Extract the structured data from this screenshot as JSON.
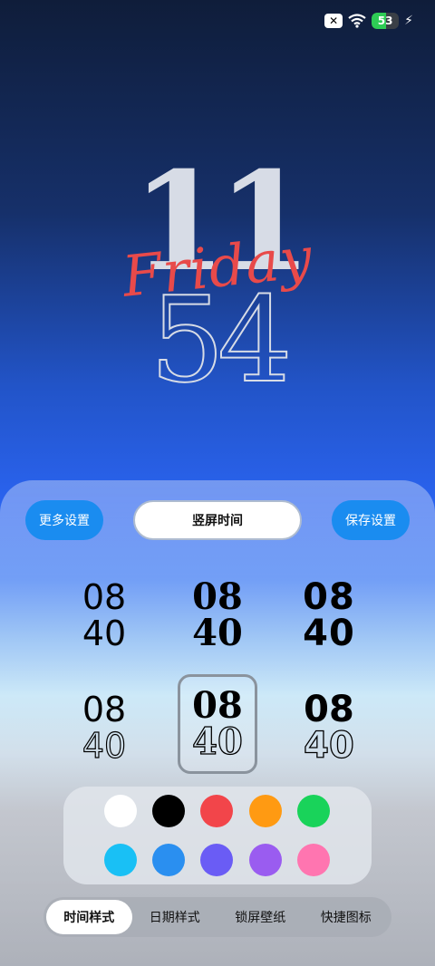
{
  "status_bar": {
    "sim_icon": "sim-x-icon",
    "wifi_icon": "wifi-icon",
    "battery_level": "53",
    "charging_icon": "bolt-icon"
  },
  "clock": {
    "hours": "11",
    "minutes": "54",
    "weekday": "Friday"
  },
  "actions": {
    "more_settings": "更多设置",
    "orientation": "竖屏时间",
    "save_settings": "保存设置"
  },
  "styles": [
    {
      "top": "08",
      "bottom": "40"
    },
    {
      "top": "08",
      "bottom": "40"
    },
    {
      "top": "08",
      "bottom": "40"
    },
    {
      "top": "08",
      "bottom": "40"
    },
    {
      "top": "08",
      "bottom": "40"
    },
    {
      "top": "08",
      "bottom": "40"
    }
  ],
  "selected_style_index": 4,
  "colors": [
    "#ffffff",
    "#000000",
    "#f2454a",
    "#ff9a12",
    "#19d35a",
    "#19c0f5",
    "#2a8ff0",
    "#6a5cf5",
    "#9a5cf0",
    "#ff75b0"
  ],
  "tabs": [
    {
      "label": "时间样式",
      "active": true
    },
    {
      "label": "日期样式",
      "active": false
    },
    {
      "label": "锁屏壁纸",
      "active": false
    },
    {
      "label": "快捷图标",
      "active": false
    }
  ]
}
